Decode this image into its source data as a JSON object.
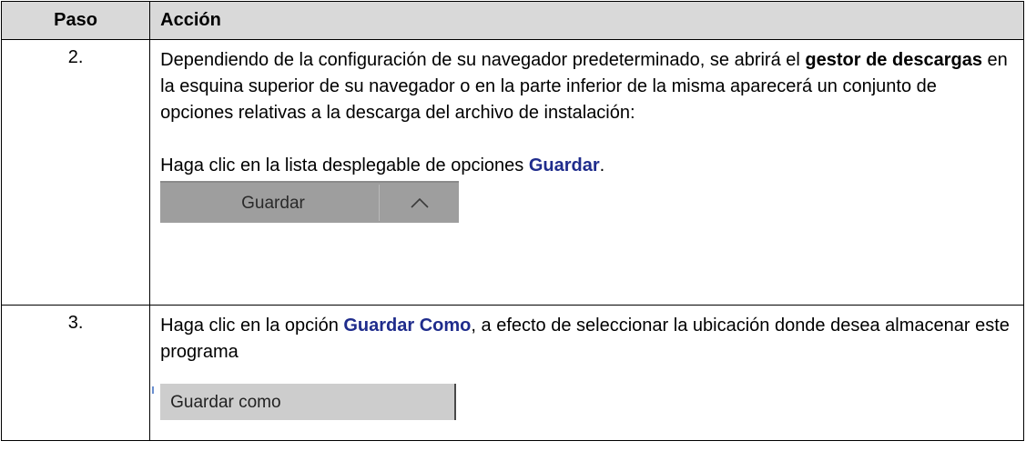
{
  "table": {
    "header_paso": "Paso",
    "header_accion": "Acción"
  },
  "step2": {
    "number": "2.",
    "text_before_bold": "Dependiendo de la configuración de su navegador predeterminado, se abrirá el ",
    "bold_term": "gestor de descargas",
    "text_after_bold": " en la esquina superior de su navegador o en la parte inferior de la misma aparecerá un conjunto de opciones relativas a la descarga del archivo de instalación:",
    "instruction_before": "Haga clic en la lista desplegable de opciones ",
    "instruction_link": "Guardar",
    "instruction_after": ".",
    "button_label": "Guardar",
    "caret_icon": "chevron-up-icon"
  },
  "step3": {
    "number": "3.",
    "text_before": "Haga clic en la opción ",
    "link": "Guardar Como",
    "text_after": ", a efecto de seleccionar la ubicación donde desea almacenar este programa",
    "menu_item_label": "Guardar como"
  },
  "colors": {
    "header_bg": "#d9d9d9",
    "link_text": "#1f2c8c",
    "guardar_bar_bg": "#9e9e9e",
    "guardar_como_bg": "#cdcdcd"
  }
}
